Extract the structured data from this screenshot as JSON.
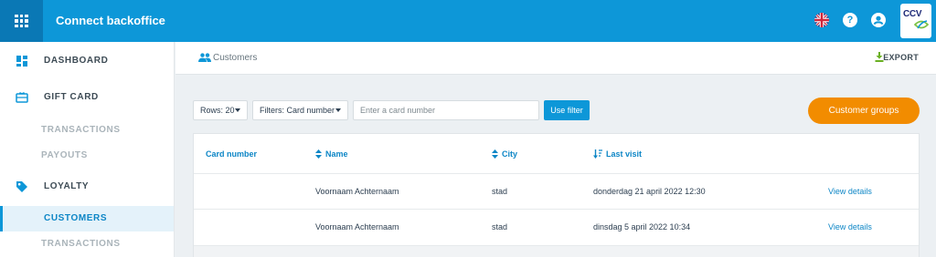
{
  "header": {
    "app_title": "Connect backoffice",
    "icons": [
      "apps-grid-icon",
      "uk-flag-icon",
      "help-icon",
      "user-icon"
    ],
    "logo_text": "CCV"
  },
  "sidebar": {
    "items": [
      {
        "label": "DASHBOARD",
        "icon": "dashboard-icon"
      },
      {
        "label": "GIFT CARD",
        "icon": "gift-card-icon"
      },
      {
        "label": "TRANSACTIONS"
      },
      {
        "label": "PAYOUTS"
      },
      {
        "label": "LOYALTY",
        "icon": "tag-icon"
      },
      {
        "label": "CUSTOMERS",
        "active": true
      },
      {
        "label": "TRANSACTIONS"
      }
    ]
  },
  "subheader": {
    "breadcrumb": "Customers",
    "export_label": "EXPORT"
  },
  "filters": {
    "rows_label": "Rows: 20",
    "filter_label": "Filters: Card number",
    "search_placeholder": "Enter a card number",
    "use_filter_label": "Use filter",
    "customer_groups_label": "Customer groups"
  },
  "table": {
    "columns": [
      "Card number",
      "Name",
      "City",
      "Last visit"
    ],
    "rows": [
      {
        "card_number": "",
        "name": "Voornaam Achternaam",
        "city": "stad",
        "last_visit": "donderdag 21 april 2022 12:30",
        "action": "View details"
      },
      {
        "card_number": "",
        "name": "Voornaam Achternaam",
        "city": "stad",
        "last_visit": "dinsdag 5 april 2022 10:34",
        "action": "View details"
      }
    ]
  },
  "colors": {
    "topbar": "#0d97d8",
    "accent": "#0d86c6",
    "orange": "#f28c00"
  }
}
